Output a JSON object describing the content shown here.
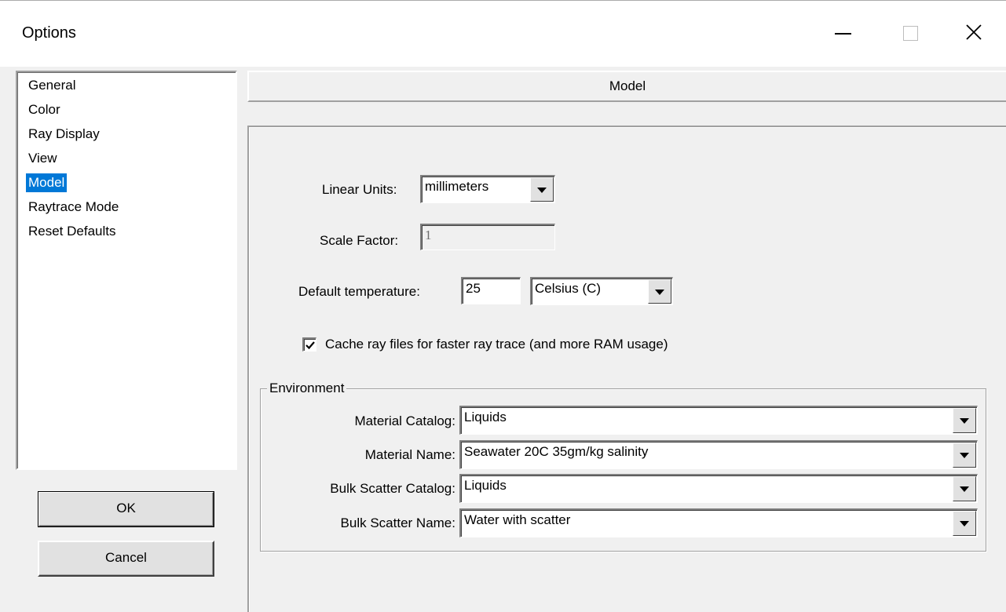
{
  "window": {
    "title": "Options"
  },
  "nav": {
    "items": [
      {
        "label": "General"
      },
      {
        "label": "Color"
      },
      {
        "label": "Ray Display"
      },
      {
        "label": "View"
      },
      {
        "label": "Model",
        "selected": true
      },
      {
        "label": "Raytrace Mode"
      },
      {
        "label": "Reset Defaults"
      }
    ]
  },
  "buttons": {
    "ok": "OK",
    "cancel": "Cancel"
  },
  "page": {
    "header": "Model",
    "linear_units": {
      "label": "Linear Units:",
      "value": "millimeters"
    },
    "scale_factor": {
      "label": "Scale Factor:",
      "value": "1"
    },
    "default_temperature": {
      "label": "Default temperature:",
      "value": "25",
      "unit": "Celsius  (C)"
    },
    "cache": {
      "label": "Cache ray files for faster ray trace (and more RAM usage)",
      "checked": true
    },
    "environment": {
      "legend": "Environment",
      "material_catalog": {
        "label": "Material Catalog:",
        "value": "Liquids"
      },
      "material_name": {
        "label": "Material Name:",
        "value": "Seawater 20C 35gm/kg salinity"
      },
      "bulk_scatter_catalog": {
        "label": "Bulk Scatter Catalog:",
        "value": "Liquids"
      },
      "bulk_scatter_name": {
        "label": "Bulk Scatter Name:",
        "value": "Water with scatter"
      }
    }
  },
  "colors": {
    "selection": "#0078d7",
    "dialog_bg": "#f0f0f0"
  }
}
